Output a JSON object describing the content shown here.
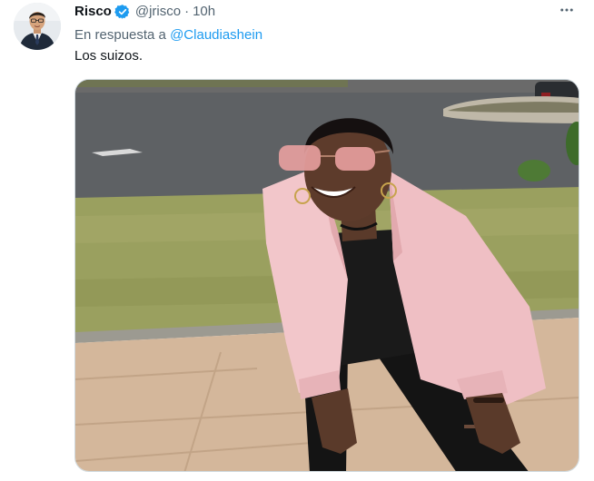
{
  "tweet": {
    "author_name": "Risco",
    "verified": true,
    "handle": "@jrisco",
    "separator": "·",
    "time": "10h",
    "reply_prefix": "En respuesta a ",
    "reply_to": "@Claudiashein",
    "text": "Los suizos.",
    "more_icon": "more-horizontal-icon",
    "verified_icon": "verified-badge-icon"
  },
  "colors": {
    "link": "#1d9bf0",
    "secondary_text": "#536471",
    "primary_text": "#0f1419",
    "verified": "#1d9bf0"
  }
}
